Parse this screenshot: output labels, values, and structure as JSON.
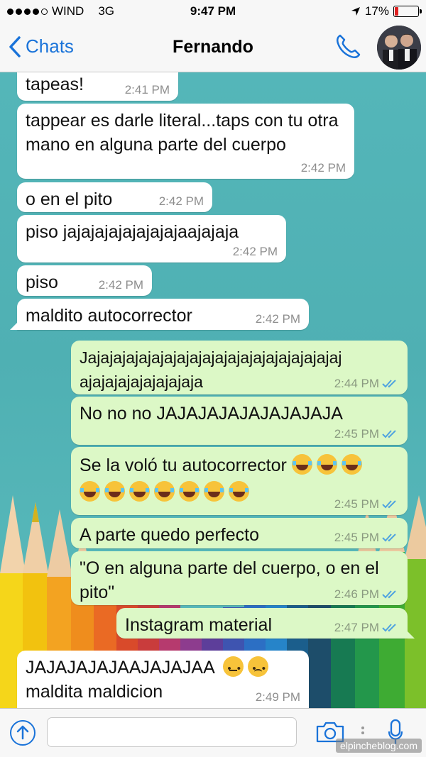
{
  "status_bar": {
    "carrier": "WIND",
    "network": "3G",
    "time": "9:47 PM",
    "battery": "17%",
    "battery_level": 0.17
  },
  "nav": {
    "back_label": "Chats",
    "title": "Fernando"
  },
  "messages": [
    {
      "dir": "in",
      "text": "tapeas!",
      "time": "2:41 PM"
    },
    {
      "dir": "in",
      "text": "tappear es darle literal...taps con tu otra mano en alguna parte del cuerpo",
      "time": "2:42 PM"
    },
    {
      "dir": "in",
      "text": "o en el pito",
      "time": "2:42 PM"
    },
    {
      "dir": "in",
      "text": "piso jajajajajajajajajaajajaja",
      "time": "2:42 PM"
    },
    {
      "dir": "in",
      "text": "piso",
      "time": "2:42 PM"
    },
    {
      "dir": "in",
      "text": "maldito autocorrector",
      "time": "2:42 PM"
    },
    {
      "dir": "out",
      "text": "Jajajajajajajajajajajajajajajajajajajajaj ajajajajajajajajaja",
      "time": "2:44 PM"
    },
    {
      "dir": "out",
      "text": "No no no JAJAJAJAJAJAJAJAJA",
      "time": "2:45 PM"
    },
    {
      "dir": "out",
      "text": "Se la voló tu autocorrector",
      "time": "2:45 PM",
      "emojis": "face-with-tears-of-joy ×10"
    },
    {
      "dir": "out",
      "text": "A parte quedo perfecto",
      "time": "2:45 PM"
    },
    {
      "dir": "out",
      "text": "\"O en alguna parte del cuerpo, o en el pito\"",
      "time": "2:46 PM"
    },
    {
      "dir": "out",
      "text": "Instagram material",
      "time": "2:47 PM"
    },
    {
      "dir": "in",
      "text": "JAJAJAJAJAAJAJAJAA",
      "text2": "maldita maldicion",
      "time": "2:49 PM",
      "emojis": "neutral-face, slightly-frowning-face"
    }
  ],
  "input": {
    "placeholder": ""
  },
  "watermark": "elpincheblog.com",
  "colors": {
    "accent": "#1a73d9",
    "incoming_bubble": "#ffffff",
    "outgoing_bubble": "#dcf8c6",
    "read_ticks": "#4fa3e0",
    "chat_background": "#54b6b9"
  },
  "icons": [
    "back-chevron-icon",
    "phone-icon",
    "contact-avatar",
    "upload-icon",
    "camera-icon",
    "microphone-icon",
    "double-check-icon"
  ]
}
